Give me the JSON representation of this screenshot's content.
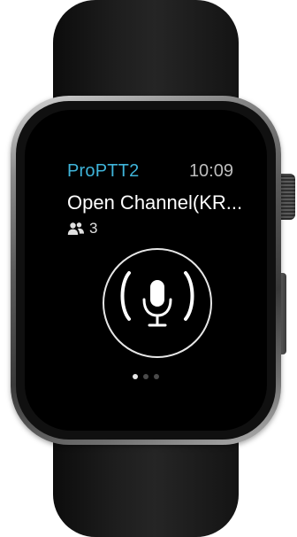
{
  "app": {
    "title": "ProPTT2",
    "time": "10:09"
  },
  "channel": {
    "name": "Open Channel(KR...",
    "member_count": "3"
  },
  "ptt": {
    "icon": "microphone-icon",
    "state_indicator": "sound-wave-brackets"
  },
  "pager": {
    "pages": 3,
    "active_index": 0
  },
  "colors": {
    "accent": "#3fb4d9",
    "clock": "#bdbdbd",
    "screen_bg": "#000000"
  }
}
